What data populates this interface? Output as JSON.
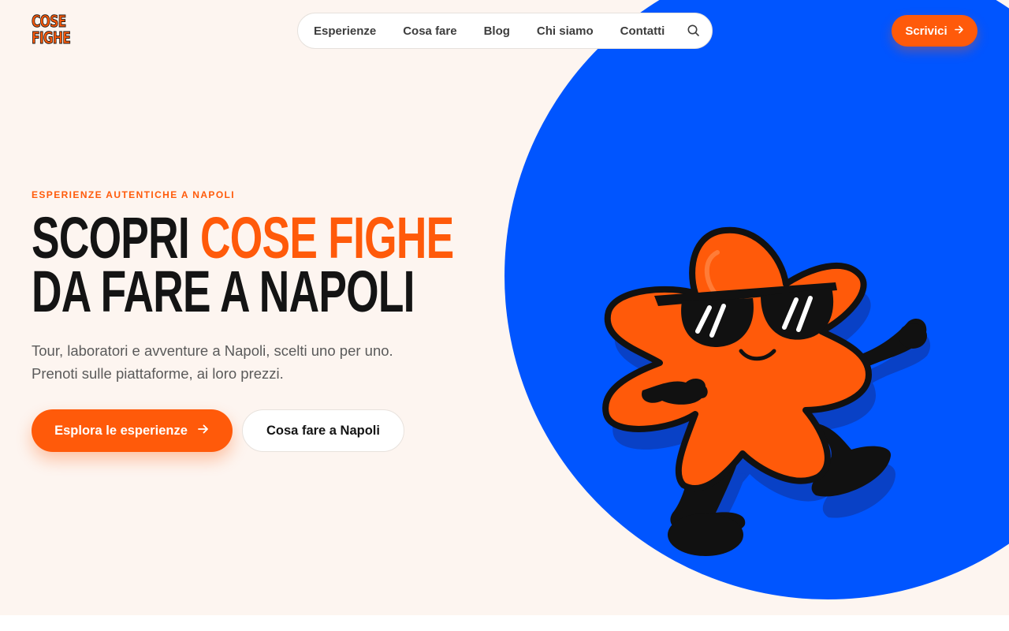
{
  "brand": {
    "logo_line1": "COSE",
    "logo_line2": "FIGHE"
  },
  "nav": {
    "items": [
      {
        "label": "Esperienze"
      },
      {
        "label": "Cosa fare"
      },
      {
        "label": "Blog"
      },
      {
        "label": "Chi siamo"
      },
      {
        "label": "Contatti"
      }
    ],
    "search_icon": "search-icon"
  },
  "header_cta": {
    "label": "Scrivici",
    "icon": "arrow-right-icon"
  },
  "hero": {
    "eyebrow": "ESPERIENZE AUTENTICHE A NAPOLI",
    "title_part1": "SCOPRI ",
    "title_highlight": "COSE FIGHE",
    "title_line2": "DA FARE A NAPOLI",
    "subtitle": "Tour, laboratori e avventure a Napoli, scelti uno per uno. Prenoti sulle piattaforme, ai loro prezzi.",
    "primary_button": "Esplora le esperienze",
    "secondary_button": "Cosa fare a Napoli",
    "illustration": "star-mascot-with-sunglasses"
  },
  "colors": {
    "accent": "#ff5a0a",
    "blob": "#0055ff",
    "background": "#fdf5f0",
    "text": "#141414"
  }
}
